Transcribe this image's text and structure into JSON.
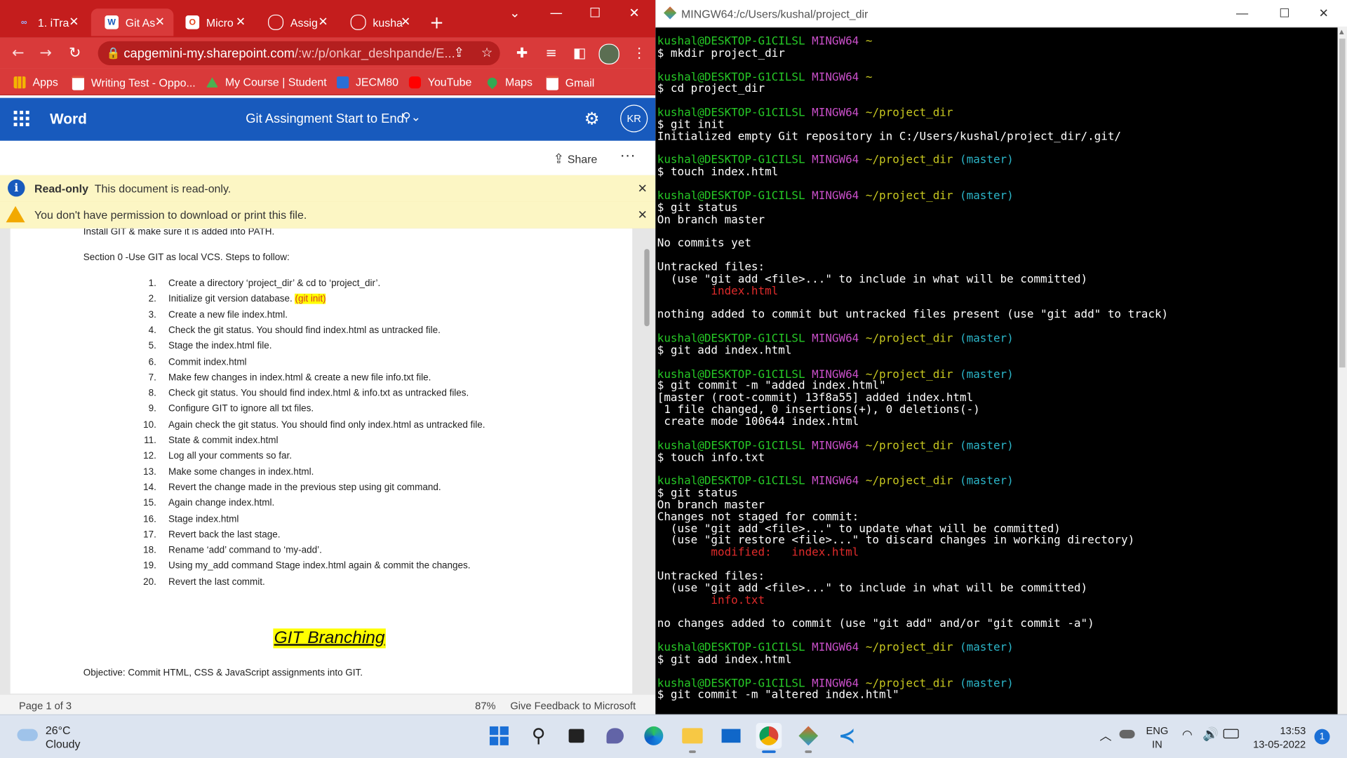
{
  "chrome": {
    "tabs": [
      {
        "label": "1. iTra",
        "icon": "infinity-icon",
        "color": "#3b5bdb"
      },
      {
        "label": "Git As",
        "icon": "word-icon",
        "color": "#185abd",
        "active": true
      },
      {
        "label": "Micro",
        "icon": "office-icon",
        "color": "#e3421b"
      },
      {
        "label": "Assig",
        "icon": "github-icon",
        "color": "#222222"
      },
      {
        "label": "kusha",
        "icon": "github-icon",
        "color": "#222222"
      }
    ],
    "tab_close": "✕",
    "new_tab": "+",
    "url_host": "capgemini-my.sharepoint.com",
    "url_path": "/:w:/p/onkar_deshpande/E...",
    "bookmarks": [
      "Apps",
      "Writing Test - Oppo...",
      "My Course | Student",
      "JECM80",
      "YouTube",
      "Maps",
      "Gmail"
    ],
    "accent": "#d93a3a"
  },
  "word": {
    "app_name": "Word",
    "doc_title": "Git Assingment Start to End",
    "avatar_initials": "KR",
    "share_label": "Share",
    "more_label": "···",
    "readonly_bold": "Read-only",
    "readonly_text": "This document is read-only.",
    "permission_text": "You don't have permission to download or print this file.",
    "close_glyph": "✕",
    "doc": {
      "line_top": "Install GIT & make sure it is added into PATH.",
      "section": "Section 0 -Use GIT as local VCS. Steps to follow:",
      "steps": [
        "Create a directory ‘project_dir’ & cd to ‘project_dir’.",
        "Initialize git version database. ",
        "Create a new file index.html.",
        "Check the git status. You should find index.html as untracked file.",
        "Stage the index.html file.",
        "Commit index.html",
        "Make few changes in index.html & create a new file info.txt file.",
        "Check git status. You should find index.html & info.txt as untracked files.",
        "Configure GIT to ignore all txt files.",
        "Again check the git status. You should find only index.html as untracked file.",
        "State & commit index.html",
        "Log all your comments so far.",
        "Make some changes in index.html.",
        "Revert the change made in the previous step using git command.",
        "Again change index.html.",
        "Stage index.html",
        "Revert back the last stage.",
        "Rename ‘add’ command to ‘my-add’.",
        "Using my_add command Stage index.html again & commit the changes.",
        "Revert the last commit."
      ],
      "step_numbers": [
        "1.",
        "2.",
        "3.",
        "4.",
        "5.",
        "6.",
        "7.",
        "8.",
        "9.",
        "10.",
        "11.",
        "12.",
        "13.",
        "14.",
        "15.",
        "16.",
        "17.",
        "18.",
        "19.",
        "20."
      ],
      "highlight": "(git init)",
      "heading": "GIT Branching",
      "objective": "Objective: Commit HTML, CSS & JavaScript assignments into GIT."
    },
    "status": {
      "page": "Page 1 of 3",
      "zoom": "87%",
      "feedback": "Give Feedback to Microsoft"
    }
  },
  "terminal": {
    "title": "MINGW64:/c/Users/kushal/project_dir",
    "lines": [
      {
        "user": "kushal@DESKTOP-G1CILSL",
        "ms": "MINGW64",
        "dir": "~",
        "branch": ""
      },
      {
        "text": "$ mkdir project_dir"
      },
      {
        "text": ""
      },
      {
        "user": "kushal@DESKTOP-G1CILSL",
        "ms": "MINGW64",
        "dir": "~",
        "branch": ""
      },
      {
        "text": "$ cd project_dir"
      },
      {
        "text": ""
      },
      {
        "user": "kushal@DESKTOP-G1CILSL",
        "ms": "MINGW64",
        "dir": "~/project_dir",
        "branch": ""
      },
      {
        "text": "$ git init"
      },
      {
        "text": "Initialized empty Git repository in C:/Users/kushal/project_dir/.git/"
      },
      {
        "text": ""
      },
      {
        "user": "kushal@DESKTOP-G1CILSL",
        "ms": "MINGW64",
        "dir": "~/project_dir",
        "branch": "(master)"
      },
      {
        "text": "$ touch index.html"
      },
      {
        "text": ""
      },
      {
        "user": "kushal@DESKTOP-G1CILSL",
        "ms": "MINGW64",
        "dir": "~/project_dir",
        "branch": "(master)"
      },
      {
        "text": "$ git status"
      },
      {
        "text": "On branch master"
      },
      {
        "text": ""
      },
      {
        "text": "No commits yet"
      },
      {
        "text": ""
      },
      {
        "text": "Untracked files:"
      },
      {
        "text": "  (use \"git add <file>...\" to include in what will be committed)"
      },
      {
        "text": "        index.html",
        "red": true
      },
      {
        "text": ""
      },
      {
        "text": "nothing added to commit but untracked files present (use \"git add\" to track)"
      },
      {
        "text": ""
      },
      {
        "user": "kushal@DESKTOP-G1CILSL",
        "ms": "MINGW64",
        "dir": "~/project_dir",
        "branch": "(master)"
      },
      {
        "text": "$ git add index.html"
      },
      {
        "text": ""
      },
      {
        "user": "kushal@DESKTOP-G1CILSL",
        "ms": "MINGW64",
        "dir": "~/project_dir",
        "branch": "(master)"
      },
      {
        "text": "$ git commit -m \"added index.html\""
      },
      {
        "text": "[master (root-commit) 13f8a55] added index.html"
      },
      {
        "text": " 1 file changed, 0 insertions(+), 0 deletions(-)"
      },
      {
        "text": " create mode 100644 index.html"
      },
      {
        "text": ""
      },
      {
        "user": "kushal@DESKTOP-G1CILSL",
        "ms": "MINGW64",
        "dir": "~/project_dir",
        "branch": "(master)"
      },
      {
        "text": "$ touch info.txt"
      },
      {
        "text": ""
      },
      {
        "user": "kushal@DESKTOP-G1CILSL",
        "ms": "MINGW64",
        "dir": "~/project_dir",
        "branch": "(master)"
      },
      {
        "text": "$ git status"
      },
      {
        "text": "On branch master"
      },
      {
        "text": "Changes not staged for commit:"
      },
      {
        "text": "  (use \"git add <file>...\" to update what will be committed)"
      },
      {
        "text": "  (use \"git restore <file>...\" to discard changes in working directory)"
      },
      {
        "text": "        modified:   index.html",
        "red": true
      },
      {
        "text": ""
      },
      {
        "text": "Untracked files:"
      },
      {
        "text": "  (use \"git add <file>...\" to include in what will be committed)"
      },
      {
        "text": "        info.txt",
        "red": true
      },
      {
        "text": ""
      },
      {
        "text": "no changes added to commit (use \"git add\" and/or \"git commit -a\")"
      },
      {
        "text": ""
      },
      {
        "user": "kushal@DESKTOP-G1CILSL",
        "ms": "MINGW64",
        "dir": "~/project_dir",
        "branch": "(master)"
      },
      {
        "text": "$ git add index.html"
      },
      {
        "text": ""
      },
      {
        "user": "kushal@DESKTOP-G1CILSL",
        "ms": "MINGW64",
        "dir": "~/project_dir",
        "branch": "(master)"
      },
      {
        "text": "$ git commit -m \"altered index.html\""
      }
    ]
  },
  "taskbar": {
    "temp": "26°C",
    "condition": "Cloudy",
    "lang": "ENG",
    "region": "IN",
    "time": "13:53",
    "date": "13-05-2022",
    "notification_count": "1"
  }
}
